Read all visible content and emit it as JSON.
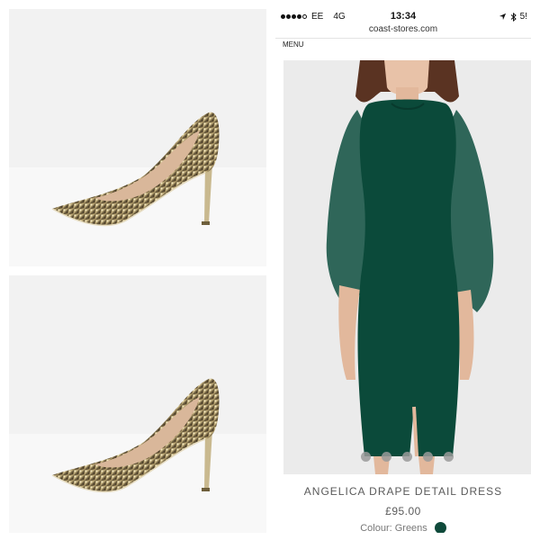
{
  "collage": {
    "top_photo": {
      "alt": "glitter court shoe"
    },
    "bottom_photo": {
      "alt": "glitter court shoe"
    }
  },
  "status_bar": {
    "carrier": "EE",
    "network": "4G",
    "time": "13:34",
    "battery": "5!"
  },
  "browser": {
    "url": "coast-stores.com"
  },
  "site": {
    "menu_label": "MENU"
  },
  "product": {
    "name": "ANGELICA DRAPE DETAIL DRESS",
    "price": "£95.00",
    "colour_label": "Colour: Greens",
    "colour_swatch": "#0f4a3b",
    "image_count": 5
  },
  "icons": {
    "location": "location-arrow-icon",
    "bluetooth": "bluetooth-icon",
    "swatch": "colour-swatch-icon"
  }
}
